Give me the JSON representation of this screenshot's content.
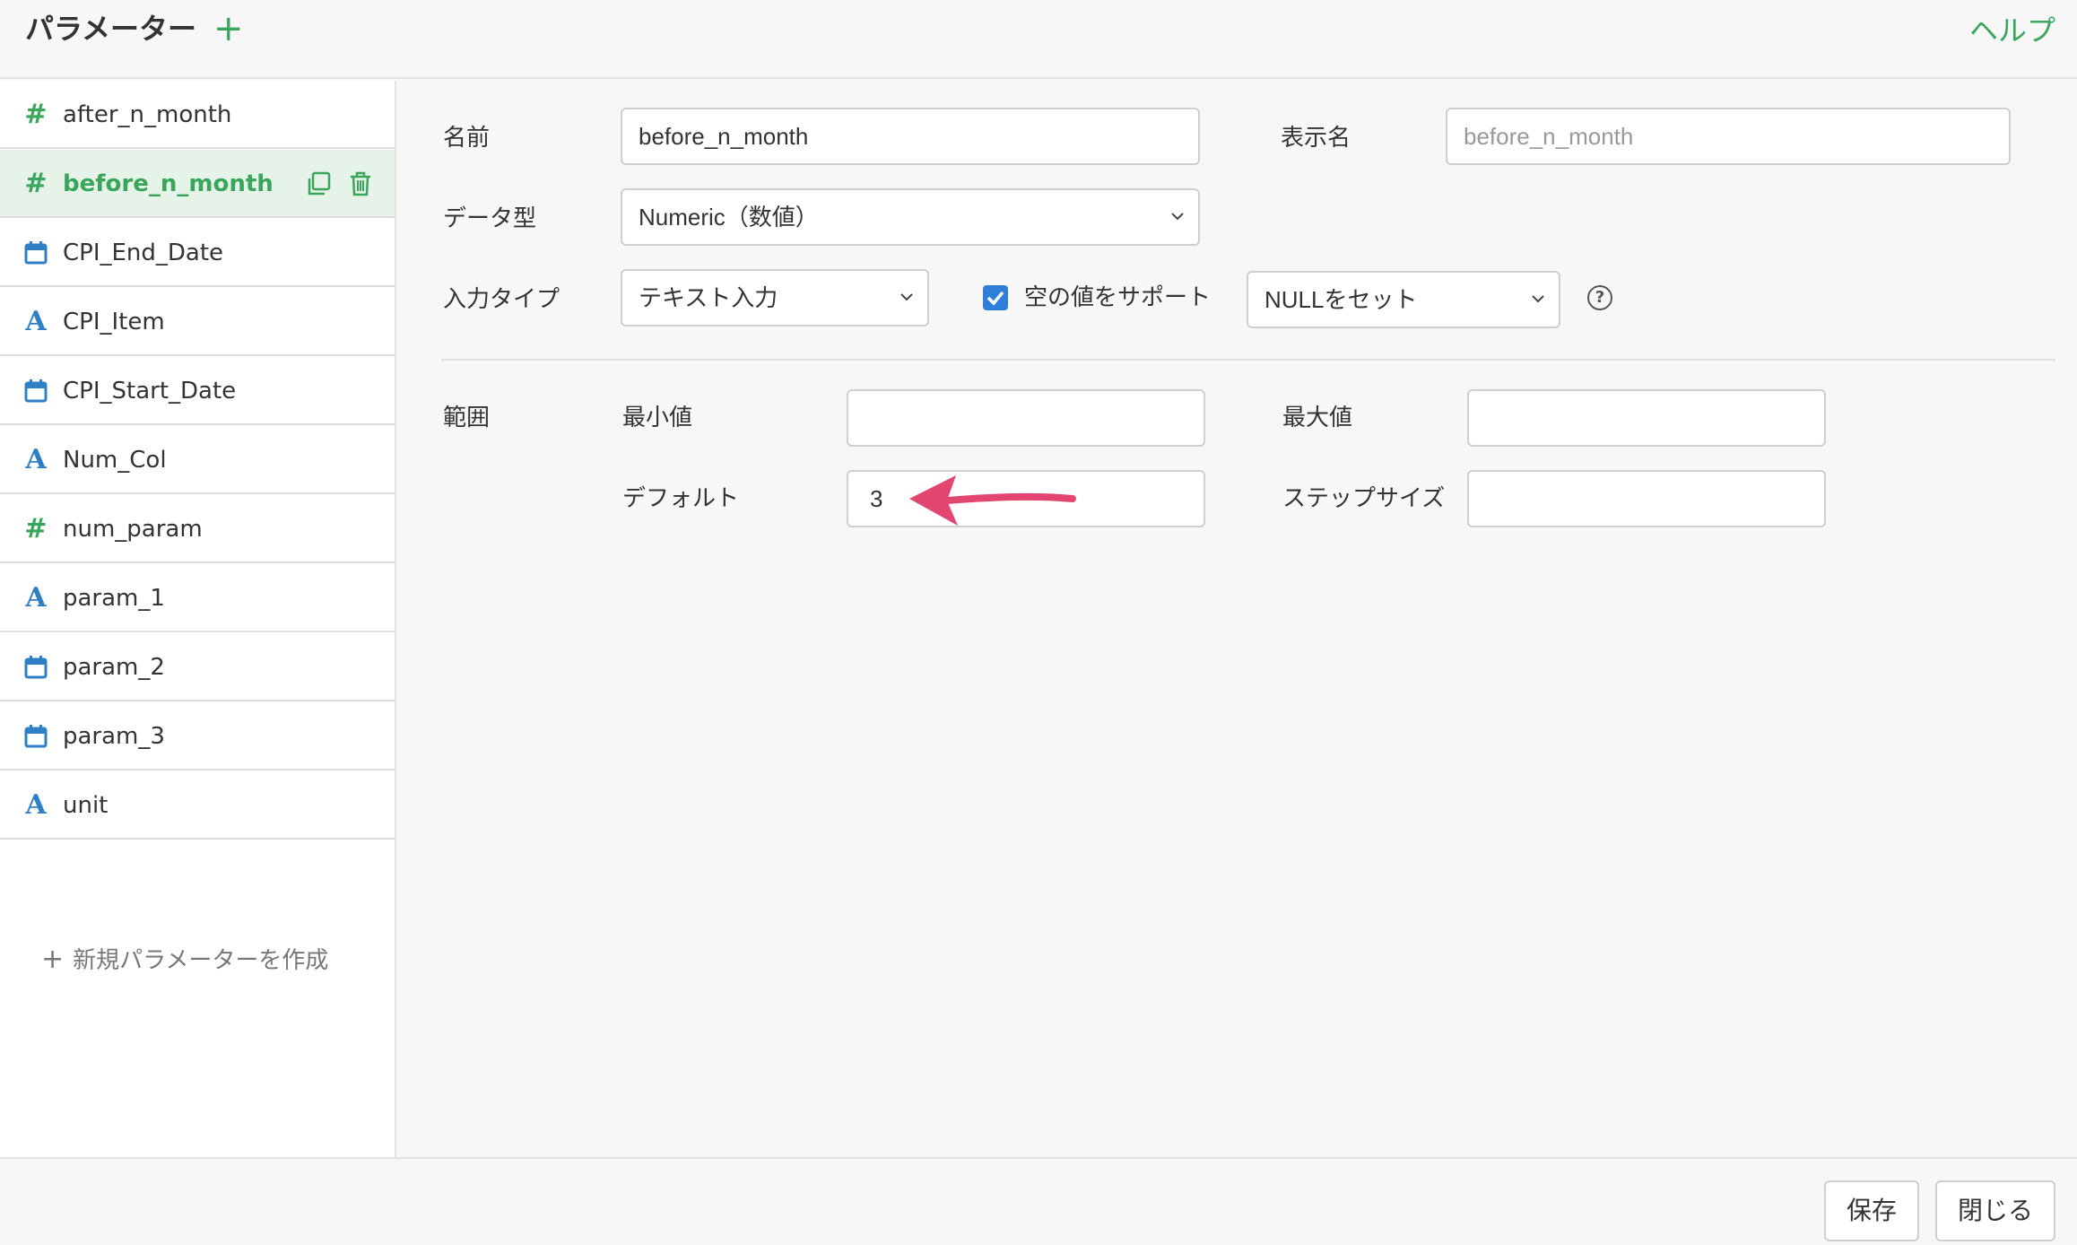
{
  "header": {
    "title": "パラメーター",
    "add_symbol": "+",
    "help_label": "ヘルプ"
  },
  "sidebar": {
    "items": [
      {
        "label": "after_n_month",
        "icon": "hash-icon"
      },
      {
        "label": "before_n_month",
        "icon": "hash-icon",
        "active": true
      },
      {
        "label": "CPI_End_Date",
        "icon": "calendar-icon"
      },
      {
        "label": "CPI_Item",
        "icon": "text-type-icon"
      },
      {
        "label": "CPI_Start_Date",
        "icon": "calendar-icon"
      },
      {
        "label": "Num_Col",
        "icon": "text-type-icon"
      },
      {
        "label": "num_param",
        "icon": "hash-icon"
      },
      {
        "label": "param_1",
        "icon": "text-type-icon"
      },
      {
        "label": "param_2",
        "icon": "calendar-icon"
      },
      {
        "label": "param_3",
        "icon": "calendar-icon"
      },
      {
        "label": "unit",
        "icon": "text-type-icon"
      }
    ],
    "new_param_label": "新規パラメーターを作成",
    "new_param_plus": "+"
  },
  "form": {
    "name_label": "名前",
    "name_value": "before_n_month",
    "display_name_label": "表示名",
    "display_name_placeholder": "before_n_month",
    "data_type_label": "データ型",
    "data_type_value": "Numeric（数値）",
    "input_type_label": "入力タイプ",
    "input_type_value": "テキスト入力",
    "support_empty_label": "空の値をサポート",
    "support_empty_checked": true,
    "null_option_value": "NULLをセット",
    "help_symbol": "?",
    "range_label": "範囲",
    "min_label": "最小値",
    "min_value": "",
    "max_label": "最大値",
    "max_value": "",
    "default_label": "デフォルト",
    "default_value": "3",
    "step_label": "ステップサイズ",
    "step_value": ""
  },
  "footer": {
    "save_label": "保存",
    "close_label": "閉じる"
  },
  "colors": {
    "accent_green": "#3aa65b",
    "icon_blue": "#2f7fc4",
    "checkbox_blue": "#2f7fd9",
    "annotation_arrow": "#e2456f"
  }
}
